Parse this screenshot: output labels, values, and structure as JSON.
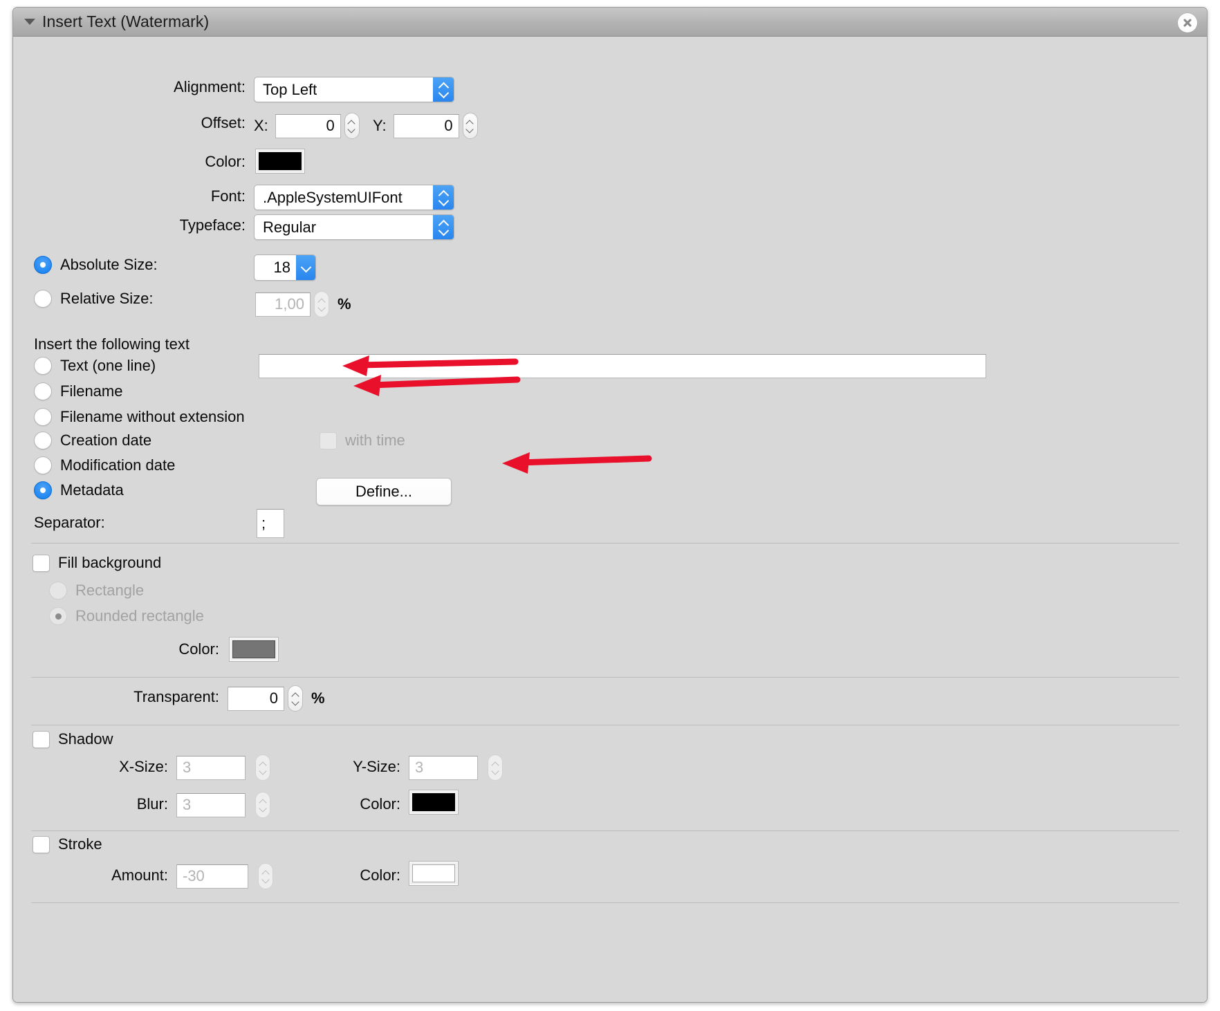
{
  "window": {
    "title": "Insert Text (Watermark)",
    "disclosure_icon": "triangle-down-icon",
    "close_icon": "close-circle-icon"
  },
  "alignment": {
    "label": "Alignment:",
    "value": "Top Left"
  },
  "offset": {
    "label": "Offset:",
    "x_label": "X:",
    "x_value": "0",
    "y_label": "Y:",
    "y_value": "0"
  },
  "text_color": {
    "label": "Color:",
    "value": "#000000"
  },
  "font": {
    "label": "Font:",
    "value": ".AppleSystemUIFont"
  },
  "typeface": {
    "label": "Typeface:",
    "value": "Regular"
  },
  "absolute_size": {
    "label": "Absolute Size:",
    "value": "18",
    "selected": true
  },
  "relative_size": {
    "label": "Relative Size:",
    "value": "1,00",
    "unit": "%",
    "selected": false
  },
  "insert_section": {
    "heading": "Insert the following text",
    "options": [
      {
        "label": "Text (one line)",
        "selected": false
      },
      {
        "label": "Filename",
        "selected": false
      },
      {
        "label": "Filename without extension",
        "selected": false
      },
      {
        "label": "Creation date",
        "selected": false
      },
      {
        "label": "Modification date",
        "selected": false
      },
      {
        "label": "Metadata",
        "selected": true
      }
    ],
    "text_one_line_value": "",
    "text_one_line_placeholder": "",
    "with_time": {
      "label": "with time",
      "checked": false,
      "enabled": false
    },
    "define_button": "Define...",
    "separator": {
      "label": "Separator:",
      "value": ";"
    }
  },
  "fill_background": {
    "label": "Fill background",
    "checked": false,
    "shape_options": [
      {
        "label": "Rectangle",
        "selected": false
      },
      {
        "label": "Rounded rectangle",
        "selected": true
      }
    ],
    "color_label": "Color:",
    "color_value": "#757575"
  },
  "transparent": {
    "label": "Transparent:",
    "value": "0",
    "unit": "%"
  },
  "shadow": {
    "label": "Shadow",
    "checked": false,
    "x_size_label": "X-Size:",
    "x_size_value": "3",
    "y_size_label": "Y-Size:",
    "y_size_value": "3",
    "blur_label": "Blur:",
    "blur_value": "3",
    "color_label": "Color:",
    "color_value": "#000000"
  },
  "stroke": {
    "label": "Stroke",
    "checked": false,
    "amount_label": "Amount:",
    "amount_value": "-30",
    "color_label": "Color:",
    "color_value": "#ffffff"
  },
  "annotations": {
    "color": "#e8102a",
    "arrows": [
      {
        "name": "arrow-to-filename"
      },
      {
        "name": "arrow-to-filename-without-extension"
      },
      {
        "name": "arrow-to-define-button"
      }
    ]
  }
}
